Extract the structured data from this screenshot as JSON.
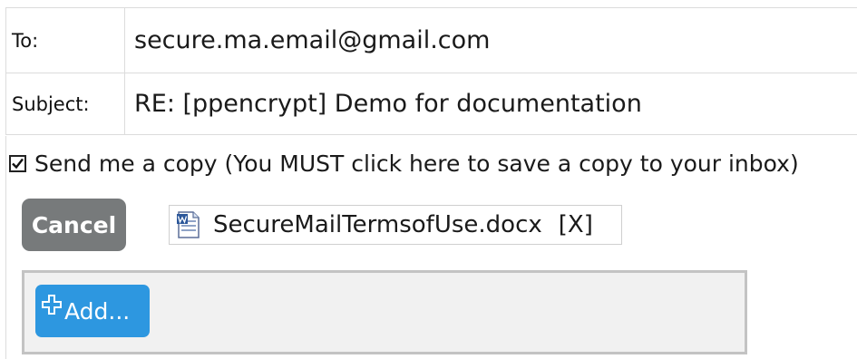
{
  "compose": {
    "to_label": "To:",
    "to_value": "secure.ma.email@gmail.com",
    "subject_label": "Subject:",
    "subject_value": "RE: [ppencrypt] Demo for documentation"
  },
  "copy_option": {
    "checked": true,
    "label": "Send me a copy (You MUST click here to save a copy to your inbox)"
  },
  "actions": {
    "cancel_label": "Cancel",
    "add_label": "Add..."
  },
  "attachment": {
    "file_name": "SecureMailTermsofUse.docx",
    "remove_label": "[X]",
    "icon": "word-document-icon"
  },
  "colors": {
    "cancel_bg": "#777a7b",
    "add_bg": "#2d97e0",
    "border": "#dcdcdc"
  }
}
